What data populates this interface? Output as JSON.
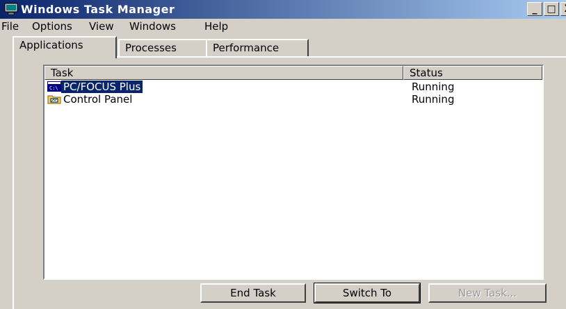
{
  "window": {
    "title": "Windows Task Manager",
    "controls": {
      "minimize": "_",
      "maximize": "□",
      "close": "X"
    }
  },
  "menu": [
    "File",
    "Options",
    "View",
    "Windows",
    "Help"
  ],
  "tabs": [
    {
      "label": "Applications",
      "active": true
    },
    {
      "label": "Processes",
      "active": false
    },
    {
      "label": "Performance",
      "active": false
    }
  ],
  "list": {
    "columns": {
      "task": "Task",
      "status": "Status"
    },
    "rows": [
      {
        "task": "PC/FOCUS Plus",
        "status": "Running",
        "selected": true,
        "icon": "dos-window-icon"
      },
      {
        "task": "Control Panel",
        "status": "Running",
        "selected": false,
        "icon": "folder-control-panel-icon"
      }
    ]
  },
  "buttons": {
    "end_task": "End Task",
    "switch_to": "Switch To",
    "new_task": "New Task..."
  },
  "colors": {
    "title_bar_start": "#0a246a",
    "title_bar_end": "#a6caf0",
    "selection": "#0a246a",
    "face": "#d4d0c8"
  }
}
